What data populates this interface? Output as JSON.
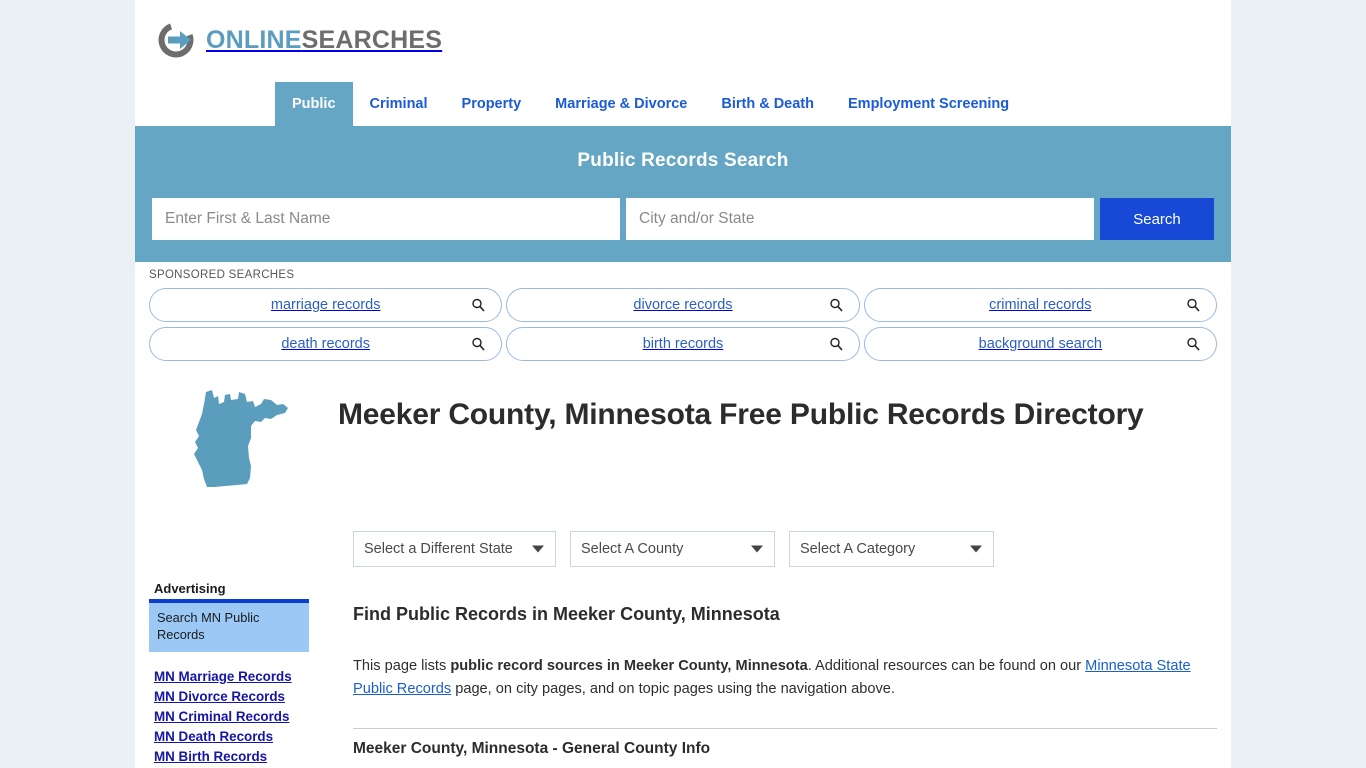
{
  "brand": {
    "logo_icon": "circle-arrow-logo-icon",
    "name_part1": "ONLINE",
    "name_part2": "SEARCHES",
    "accent_blue": "#5b9dc0",
    "accent_grey": "#6d6d6d"
  },
  "nav": {
    "tabs": [
      {
        "label": "Public",
        "active": true
      },
      {
        "label": "Criminal",
        "active": false
      },
      {
        "label": "Property",
        "active": false
      },
      {
        "label": "Marriage & Divorce",
        "active": false
      },
      {
        "label": "Birth & Death",
        "active": false
      },
      {
        "label": "Employment Screening",
        "active": false
      }
    ]
  },
  "banner": {
    "title": "Public Records Search",
    "background_color": "#65a6c4",
    "name_input": {
      "value": "",
      "placeholder": "Enter First & Last Name"
    },
    "city_input": {
      "value": "",
      "placeholder": "City and/or State"
    },
    "search_button": {
      "label": "Search",
      "color": "#1748d6"
    }
  },
  "sponsored": {
    "label": "SPONSORED SEARCHES",
    "row1": [
      {
        "label": "marriage records",
        "icon": "magnifier-icon"
      },
      {
        "label": "divorce records",
        "icon": "magnifier-icon"
      },
      {
        "label": "criminal records",
        "icon": "magnifier-icon"
      }
    ],
    "row2": [
      {
        "label": "death records",
        "icon": "magnifier-icon"
      },
      {
        "label": "birth records",
        "icon": "magnifier-icon"
      },
      {
        "label": "background search",
        "icon": "magnifier-icon"
      }
    ]
  },
  "page": {
    "map_icon": "minnesota-state-map-icon",
    "map_color": "#5b9dbd",
    "title": "Meeker County, Minnesota Free Public Records Directory"
  },
  "filters": [
    {
      "name": "state",
      "label": "Select a Different State"
    },
    {
      "name": "county",
      "label": "Select A County"
    },
    {
      "name": "category",
      "label": "Select A Category"
    }
  ],
  "main": {
    "heading": "Find Public Records in Meeker County, Minnesota",
    "paragraph": {
      "part1": "This page lists ",
      "bold1": "public record sources in Meeker County, Minnesota",
      "part2": ". Additional resources can be found on our ",
      "link1": "Minnesota State Public Records",
      "part3": " page, on city pages, and on topic pages using the navigation above."
    },
    "subsection_heading": "Meeker County, Minnesota - General County Info"
  },
  "sidebar": {
    "heading": "Advertising",
    "ad_box_text": "Search MN Public Records",
    "links": [
      "MN Marriage Records",
      "MN Divorce Records",
      "MN Criminal Records",
      "MN Death Records",
      "MN Birth Records"
    ]
  }
}
